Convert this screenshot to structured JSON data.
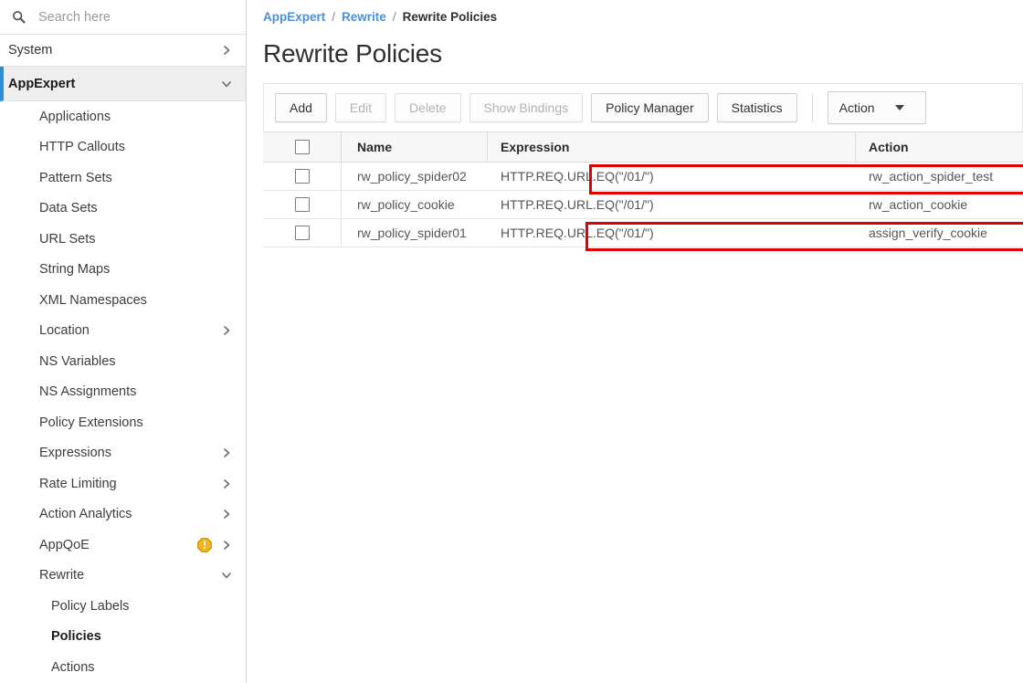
{
  "search": {
    "placeholder": "Search here",
    "value": "",
    "icon": "search-icon"
  },
  "sidebar": {
    "top_sections": [
      {
        "label": "System",
        "chevron": "chevron-right-icon",
        "active": false
      },
      {
        "label": "AppExpert",
        "chevron": "chevron-down-icon",
        "active": true
      }
    ],
    "items": [
      {
        "label": "Applications",
        "chevron": "",
        "badge": "",
        "level": 1,
        "current": false
      },
      {
        "label": "HTTP Callouts",
        "chevron": "",
        "badge": "",
        "level": 1,
        "current": false
      },
      {
        "label": "Pattern Sets",
        "chevron": "",
        "badge": "",
        "level": 1,
        "current": false
      },
      {
        "label": "Data Sets",
        "chevron": "",
        "badge": "",
        "level": 1,
        "current": false
      },
      {
        "label": "URL Sets",
        "chevron": "",
        "badge": "",
        "level": 1,
        "current": false
      },
      {
        "label": "String Maps",
        "chevron": "",
        "badge": "",
        "level": 1,
        "current": false
      },
      {
        "label": "XML Namespaces",
        "chevron": "",
        "badge": "",
        "level": 1,
        "current": false
      },
      {
        "label": "Location",
        "chevron": "chevron-right-icon",
        "badge": "",
        "level": 1,
        "current": false
      },
      {
        "label": "NS Variables",
        "chevron": "",
        "badge": "",
        "level": 1,
        "current": false
      },
      {
        "label": "NS Assignments",
        "chevron": "",
        "badge": "",
        "level": 1,
        "current": false
      },
      {
        "label": "Policy Extensions",
        "chevron": "",
        "badge": "",
        "level": 1,
        "current": false
      },
      {
        "label": "Expressions",
        "chevron": "chevron-right-icon",
        "badge": "",
        "level": 1,
        "current": false
      },
      {
        "label": "Rate Limiting",
        "chevron": "chevron-right-icon",
        "badge": "",
        "level": 1,
        "current": false
      },
      {
        "label": "Action Analytics",
        "chevron": "chevron-right-icon",
        "badge": "",
        "level": 1,
        "current": false
      },
      {
        "label": "AppQoE",
        "chevron": "chevron-right-icon",
        "badge": "warning-icon",
        "level": 1,
        "current": false
      },
      {
        "label": "Rewrite",
        "chevron": "chevron-down-icon",
        "badge": "",
        "level": 1,
        "current": false
      },
      {
        "label": "Policy Labels",
        "chevron": "",
        "badge": "",
        "level": 2,
        "current": false
      },
      {
        "label": "Policies",
        "chevron": "",
        "badge": "",
        "level": 2,
        "current": true
      },
      {
        "label": "Actions",
        "chevron": "",
        "badge": "",
        "level": 2,
        "current": false
      }
    ]
  },
  "breadcrumb": {
    "items": [
      "AppExpert",
      "Rewrite",
      "Rewrite Policies"
    ],
    "separator": "/"
  },
  "page": {
    "title": "Rewrite Policies"
  },
  "toolbar": {
    "buttons": [
      {
        "label": "Add",
        "disabled": false
      },
      {
        "label": "Edit",
        "disabled": true
      },
      {
        "label": "Delete",
        "disabled": true
      },
      {
        "label": "Show Bindings",
        "disabled": true
      },
      {
        "label": "Policy Manager",
        "disabled": false
      },
      {
        "label": "Statistics",
        "disabled": false
      }
    ],
    "action_dropdown": {
      "label": "Action",
      "icon": "chevron-down-icon"
    }
  },
  "table": {
    "columns": [
      "",
      "Name",
      "Expression",
      "Action"
    ],
    "select_all_checked": false,
    "rows": [
      {
        "checked": false,
        "name": "rw_policy_spider02",
        "expression": "HTTP.REQ.URL.EQ(\"/01/\")",
        "action": "rw_action_spider_test",
        "highlighted": true
      },
      {
        "checked": false,
        "name": "rw_policy_cookie",
        "expression": "HTTP.REQ.URL.EQ(\"/01/\")",
        "action": "rw_action_cookie",
        "highlighted": false
      },
      {
        "checked": false,
        "name": "rw_policy_spider01",
        "expression": "HTTP.REQ.URL.EQ(\"/01/\")",
        "action": "assign_verify_cookie",
        "highlighted": true
      }
    ]
  },
  "colors": {
    "accent_blue": "#2a8fd8",
    "link_blue": "#4a90d9",
    "annotation_red": "#e00000",
    "warning_amber": "#f0b41e",
    "active_row_bg": "#eeeeee",
    "header_bg": "#f7f7f7"
  }
}
